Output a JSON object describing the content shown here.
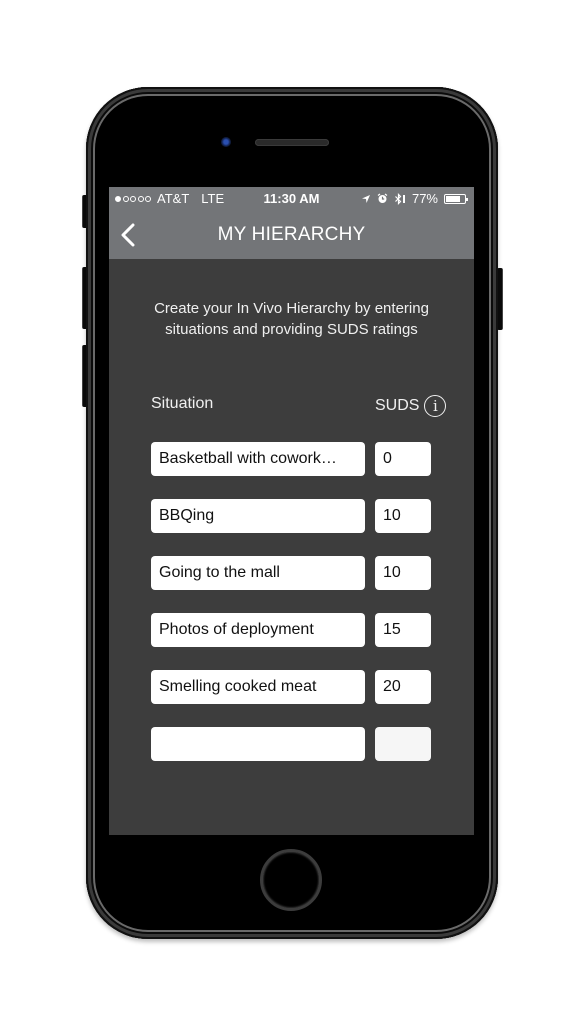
{
  "status_bar": {
    "signal_bars_filled": 1,
    "signal_bars_total": 5,
    "carrier": "AT&T",
    "network": "LTE",
    "time": "11:30 AM",
    "icons": [
      "location-arrow-icon",
      "alarm-icon",
      "bluetooth-icon"
    ],
    "battery_percent_label": "77%",
    "battery_level": 0.77
  },
  "navbar": {
    "back_icon": "chevron-left-icon",
    "title": "MY HIERARCHY"
  },
  "intro_text": "Create your In Vivo Hierarchy by entering situations and providing SUDS ratings",
  "columns": {
    "situation": "Situation",
    "suds": "SUDS",
    "info_icon": "info-icon",
    "info_glyph": "i"
  },
  "rows": [
    {
      "situation": "Basketball with coworkers",
      "situation_display": "Basketball with cowork…",
      "suds": "0"
    },
    {
      "situation": "BBQing",
      "situation_display": "BBQing",
      "suds": "10"
    },
    {
      "situation": "Going to the mall",
      "situation_display": "Going to the mall",
      "suds": "10"
    },
    {
      "situation": "Photos of deployment",
      "situation_display": "Photos of deployment",
      "suds": "15"
    },
    {
      "situation": "Smelling cooked meat",
      "situation_display": "Smelling cooked meat",
      "suds": "20"
    },
    {
      "situation": "",
      "situation_display": "",
      "suds": ""
    }
  ]
}
